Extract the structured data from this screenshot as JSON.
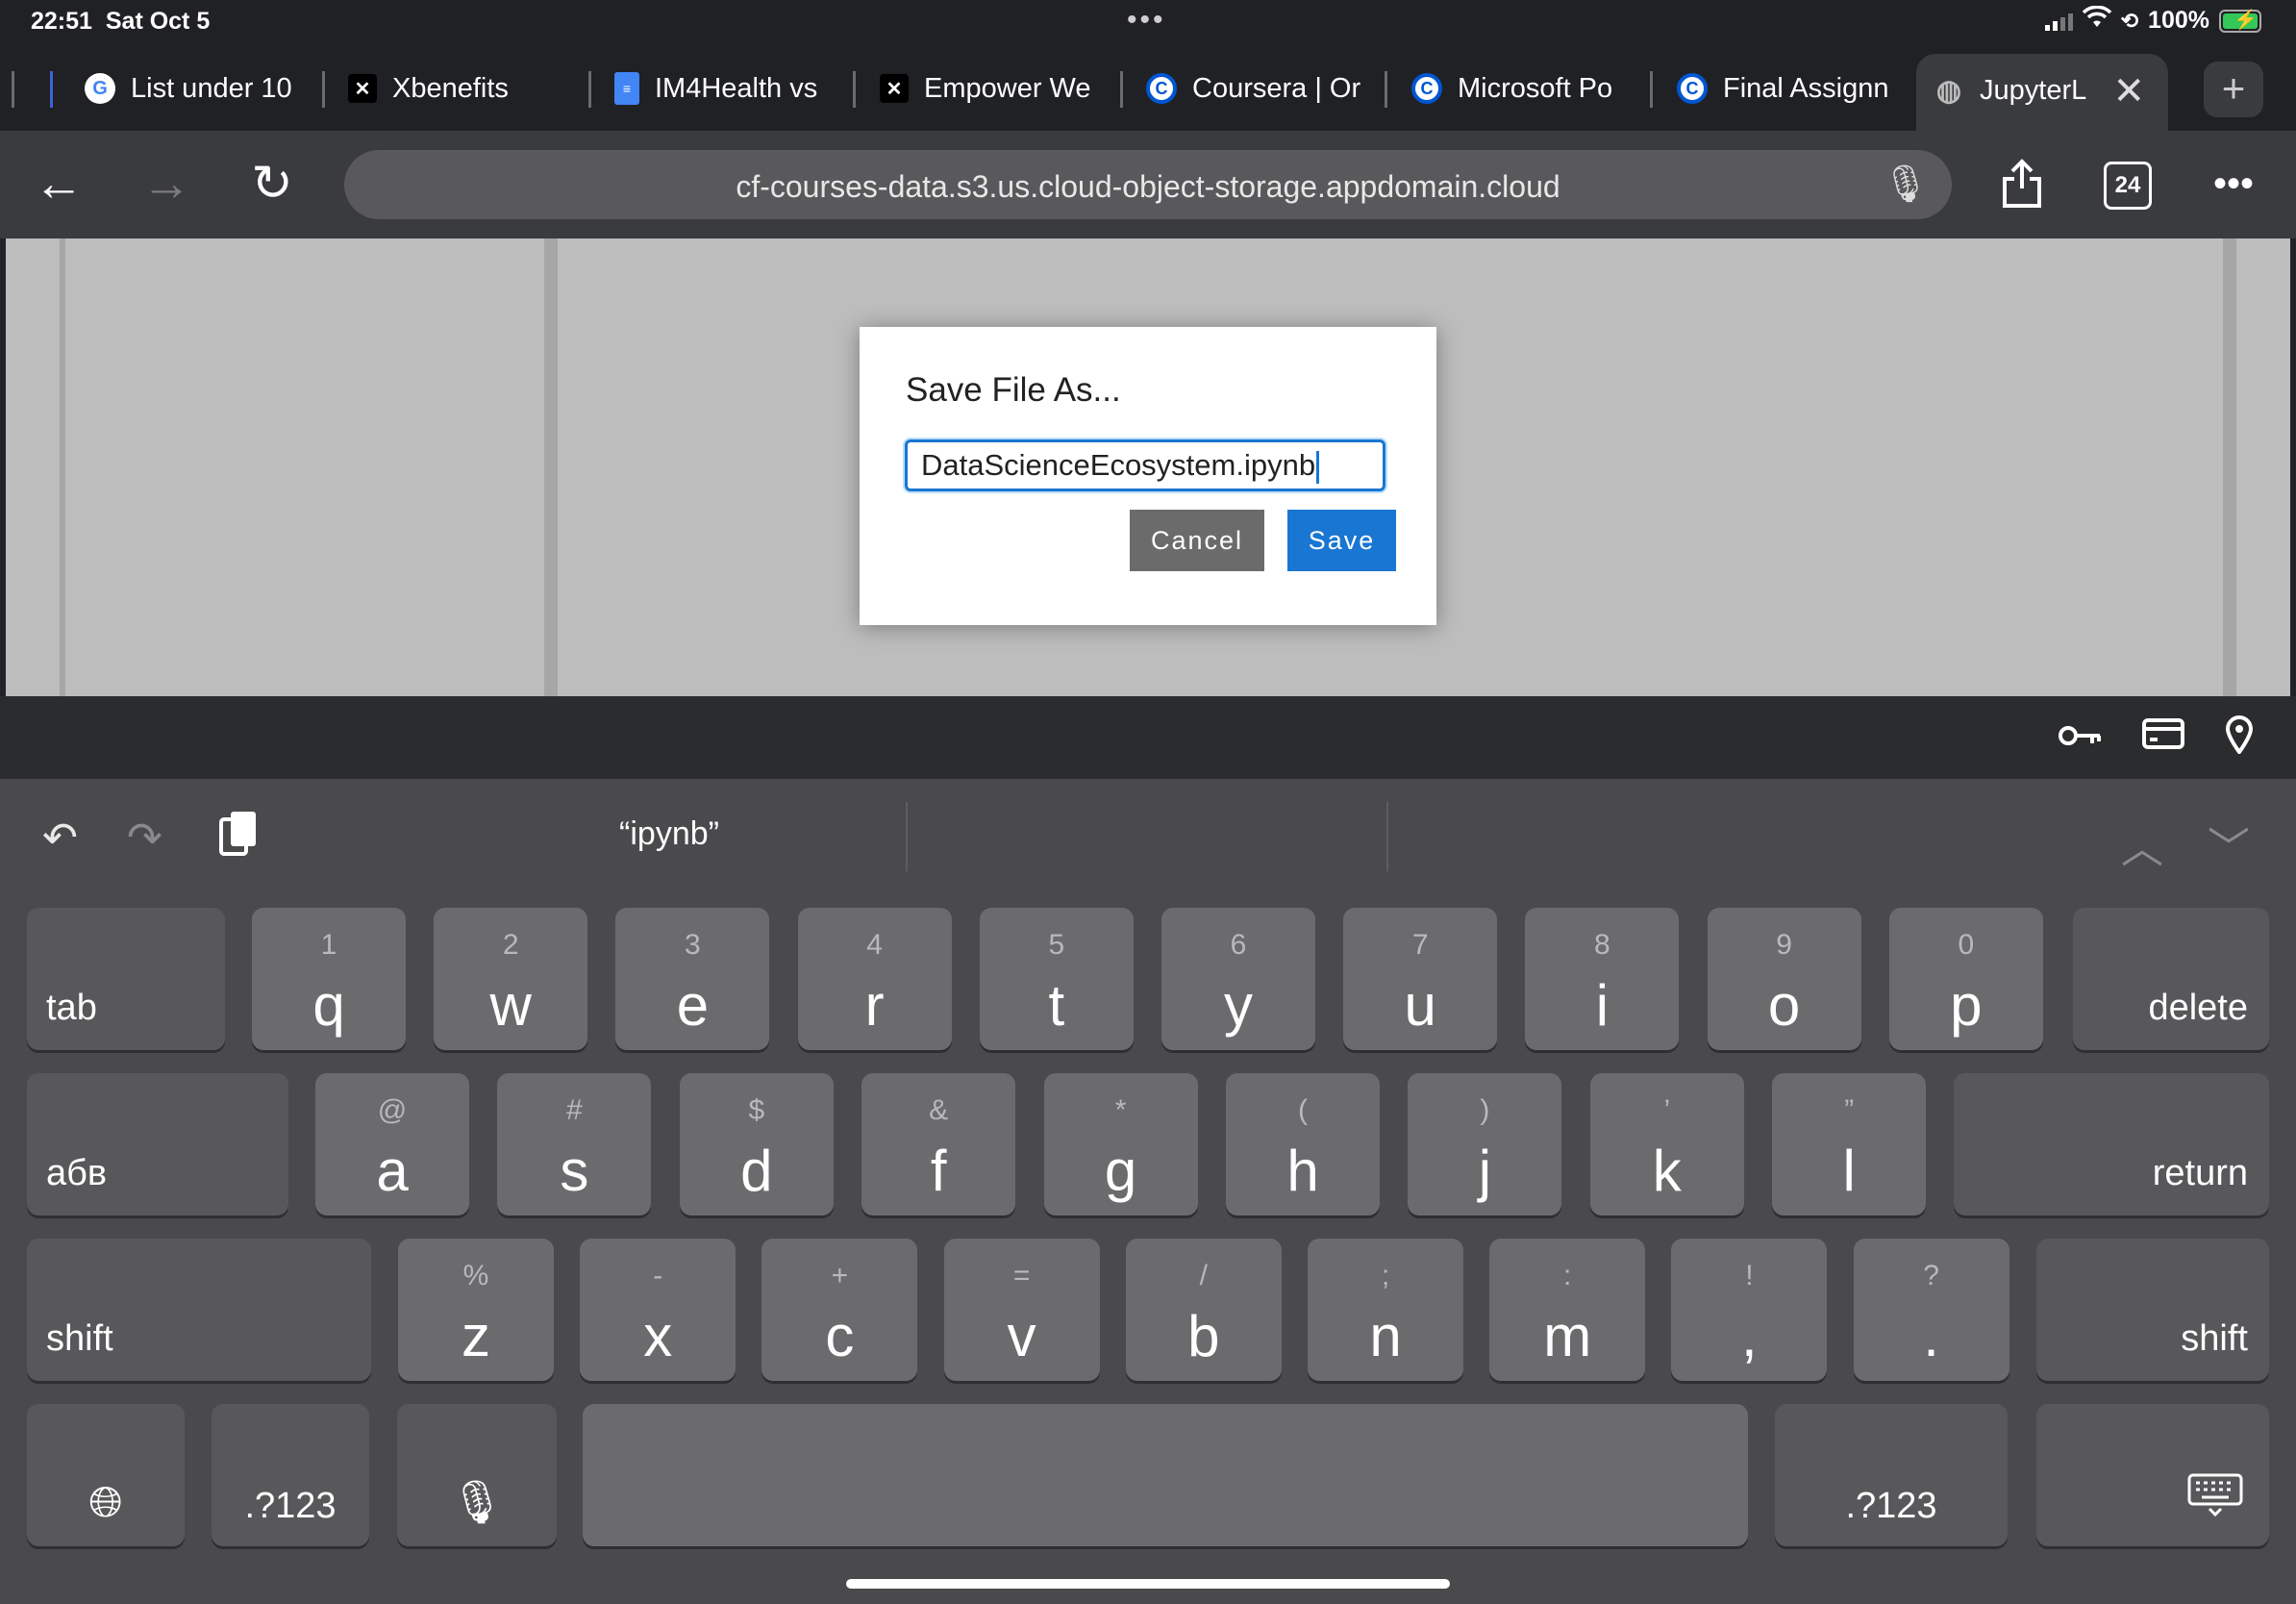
{
  "status_bar": {
    "time": "22:51",
    "date": "Sat Oct 5",
    "battery": "100%",
    "dots": "•••"
  },
  "tabs": [
    {
      "label": "List under 10",
      "icon": "google-icon"
    },
    {
      "label": "Xbenefits",
      "icon": "x-icon"
    },
    {
      "label": "IM4Health vs",
      "icon": "docs-icon"
    },
    {
      "label": "Empower We",
      "icon": "x-icon"
    },
    {
      "label": "Coursera | Or",
      "icon": "coursera-icon"
    },
    {
      "label": "Microsoft Po",
      "icon": "coursera-icon"
    },
    {
      "label": "Final Assignn",
      "icon": "coursera-icon"
    },
    {
      "label": "JupyterL",
      "icon": "globe-icon"
    }
  ],
  "toolbar": {
    "url": "cf-courses-data.s3.us.cloud-object-storage.appdomain.cloud",
    "tab_count": "24"
  },
  "dialog": {
    "title": "Save File As...",
    "filename": "DataScienceEcosystem.ipynb",
    "cancel_label": "Cancel",
    "save_label": "Save"
  },
  "keyboard": {
    "prediction": "“ipynb”",
    "row1": [
      {
        "main": "q",
        "sub": "1"
      },
      {
        "main": "w",
        "sub": "2"
      },
      {
        "main": "e",
        "sub": "3"
      },
      {
        "main": "r",
        "sub": "4"
      },
      {
        "main": "t",
        "sub": "5"
      },
      {
        "main": "y",
        "sub": "6"
      },
      {
        "main": "u",
        "sub": "7"
      },
      {
        "main": "i",
        "sub": "8"
      },
      {
        "main": "o",
        "sub": "9"
      },
      {
        "main": "p",
        "sub": "0"
      }
    ],
    "row2": [
      {
        "main": "a",
        "sub": "@"
      },
      {
        "main": "s",
        "sub": "#"
      },
      {
        "main": "d",
        "sub": "$"
      },
      {
        "main": "f",
        "sub": "&"
      },
      {
        "main": "g",
        "sub": "*"
      },
      {
        "main": "h",
        "sub": "("
      },
      {
        "main": "j",
        "sub": ")"
      },
      {
        "main": "k",
        "sub": "’"
      },
      {
        "main": "l",
        "sub": "”"
      }
    ],
    "row3": [
      {
        "main": "z",
        "sub": "%"
      },
      {
        "main": "x",
        "sub": "-"
      },
      {
        "main": "c",
        "sub": "+"
      },
      {
        "main": "v",
        "sub": "="
      },
      {
        "main": "b",
        "sub": "/"
      },
      {
        "main": "n",
        "sub": ";"
      },
      {
        "main": "m",
        "sub": ":"
      },
      {
        "main": ",",
        "sub": "!"
      },
      {
        "main": ".",
        "sub": "?"
      }
    ],
    "tab_label": "tab",
    "delete_label": "delete",
    "lang_label": "абв",
    "return_label": "return",
    "shift_label": "shift",
    "numbers_label": ".?123"
  }
}
